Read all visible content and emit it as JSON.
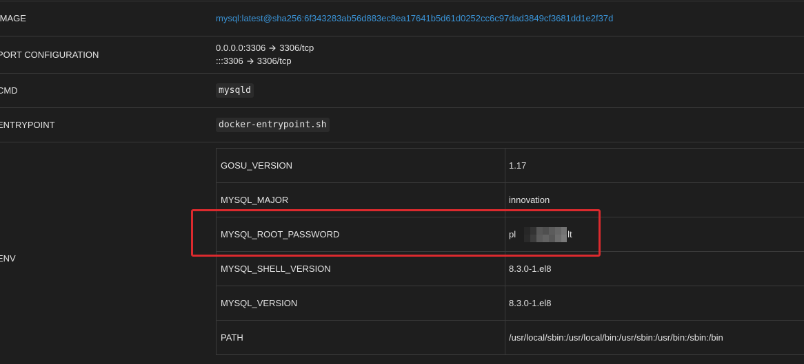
{
  "image": {
    "label": "IMAGE",
    "value": "mysql:latest@sha256:6f343283ab56d883ec8ea17641b5d61d0252cc6c97dad3849cf3681dd1e2f37d"
  },
  "port_configuration": {
    "label": "PORT CONFIGURATION",
    "mappings": [
      {
        "host": "0.0.0.0:3306",
        "container": "3306/tcp"
      },
      {
        "host": ":::3306",
        "container": "3306/tcp"
      }
    ]
  },
  "cmd": {
    "label": "CMD",
    "value": "mysqld"
  },
  "entrypoint": {
    "label": "ENTRYPOINT",
    "value": "docker-entrypoint.sh"
  },
  "env": {
    "label": "ENV",
    "variables": [
      {
        "name": "GOSU_VERSION",
        "value": "1.17"
      },
      {
        "name": "MYSQL_MAJOR",
        "value": "innovation"
      },
      {
        "name": "MYSQL_ROOT_PASSWORD",
        "value_start": "pl",
        "value_end": "lt"
      },
      {
        "name": "MYSQL_SHELL_VERSION",
        "value": "8.3.0-1.el8"
      },
      {
        "name": "MYSQL_VERSION",
        "value": "8.3.0-1.el8"
      },
      {
        "name": "PATH",
        "value": "/usr/local/sbin:/usr/local/bin:/usr/sbin:/usr/bin:/sbin:/bin"
      }
    ]
  },
  "icons": {
    "port_arrow": "arrow-right-icon"
  },
  "colors": {
    "background": "#1e1e1e",
    "text": "#e3e3e3",
    "link": "#3a93d6",
    "border": "#3a3a3a",
    "code_background": "#2b2b2b",
    "highlight": "#dc2a2e"
  }
}
